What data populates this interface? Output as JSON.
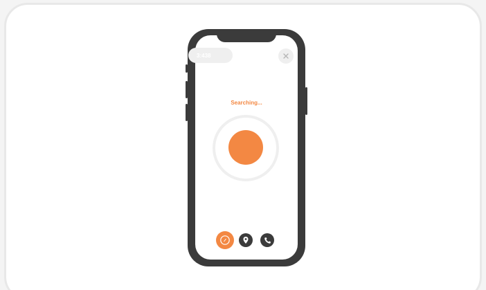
{
  "phone": {
    "timer": "3:438",
    "status_text": "Searching...",
    "close_icon": "close-icon"
  },
  "bottom_nav": [
    {
      "name": "compass",
      "icon": "compass-icon"
    },
    {
      "name": "location",
      "icon": "location-pin-icon"
    },
    {
      "name": "call",
      "icon": "phone-icon"
    }
  ],
  "colors": {
    "accent": "#f38843",
    "dark": "#3b3b3b",
    "light": "#efefef",
    "white": "#ffffff"
  }
}
